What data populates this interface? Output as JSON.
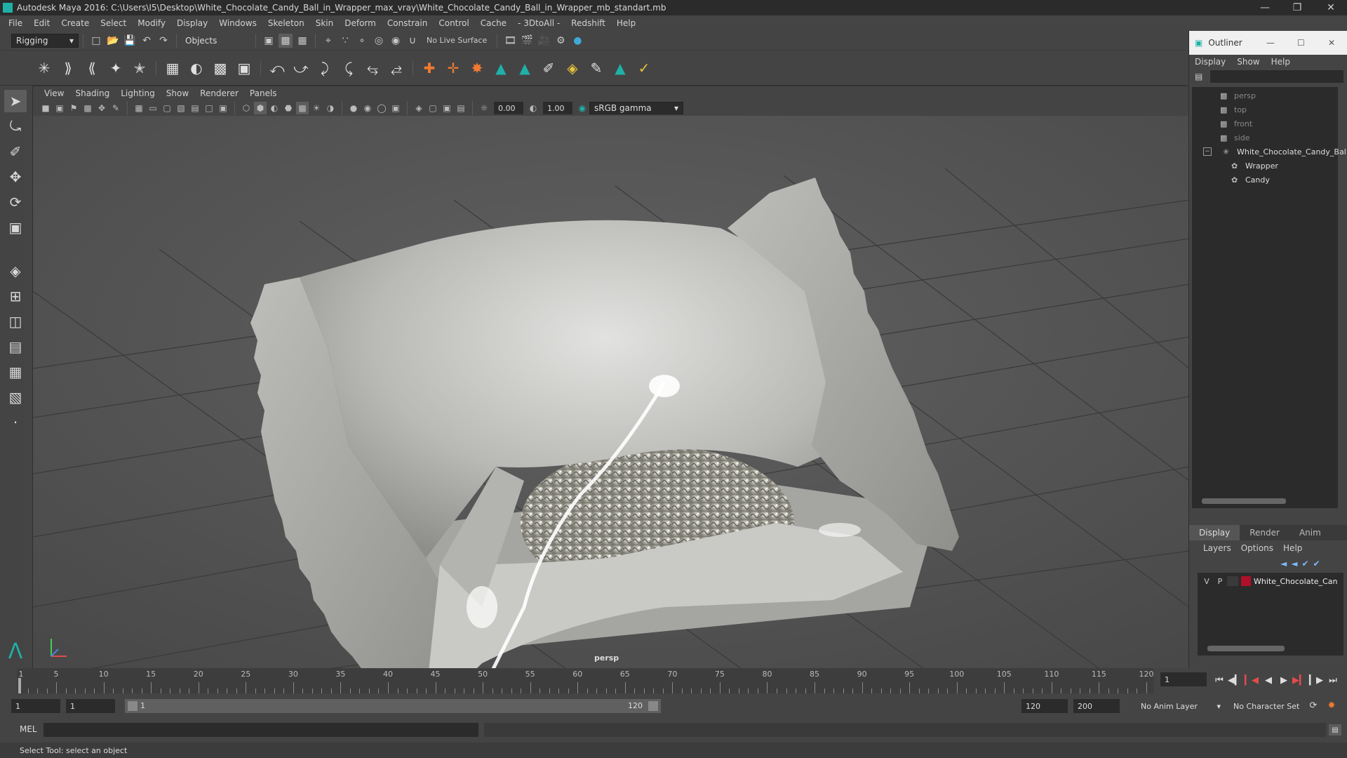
{
  "window": {
    "title": "Autodesk Maya 2016: C:\\Users\\I5\\Desktop\\White_Chocolate_Candy_Ball_in_Wrapper_max_vray\\White_Chocolate_Candy_Ball_in_Wrapper_mb_standart.mb"
  },
  "menubar": {
    "items": [
      "File",
      "Edit",
      "Create",
      "Select",
      "Modify",
      "Display",
      "Windows",
      "Skeleton",
      "Skin",
      "Deform",
      "Constrain",
      "Control",
      "Cache",
      "- 3DtoAll -",
      "Redshift",
      "Help"
    ]
  },
  "statusline": {
    "mode": "Rigging",
    "selection_mode": "Objects",
    "live_surface": "No Live Surface"
  },
  "viewport": {
    "menu": [
      "View",
      "Shading",
      "Lighting",
      "Show",
      "Renderer",
      "Panels"
    ],
    "exposure": "0.00",
    "gamma": "1.00",
    "color_space": "sRGB gamma",
    "camera_label": "persp"
  },
  "outliner": {
    "title": "Outliner",
    "menu": [
      "Display",
      "Show",
      "Help"
    ],
    "items": [
      {
        "label": "persp",
        "icon": "camera-icon"
      },
      {
        "label": "top",
        "icon": "camera-icon"
      },
      {
        "label": "front",
        "icon": "camera-icon"
      },
      {
        "label": "side",
        "icon": "camera-icon"
      },
      {
        "label": "White_Chocolate_Candy_Bal",
        "icon": "group-icon"
      },
      {
        "label": "Wrapper",
        "icon": "mesh-icon"
      },
      {
        "label": "Candy",
        "icon": "mesh-icon"
      }
    ]
  },
  "layers": {
    "tabs": [
      "Display",
      "Render",
      "Anim"
    ],
    "menu": [
      "Layers",
      "Options",
      "Help"
    ],
    "rows": [
      {
        "visible": "V",
        "playback": "P",
        "name": "White_Chocolate_Can",
        "color": "#b0102a"
      }
    ]
  },
  "timeline": {
    "ticks": [
      "1",
      "5",
      "10",
      "15",
      "20",
      "25",
      "30",
      "35",
      "40",
      "45",
      "50",
      "55",
      "60",
      "65",
      "70",
      "75",
      "80",
      "85",
      "90",
      "95",
      "100",
      "105",
      "110",
      "115",
      "120"
    ],
    "current_frame": "1"
  },
  "range": {
    "start": "1",
    "playback_start": "1",
    "bar_start": "1",
    "bar_end": "120",
    "playback_end": "120",
    "end": "200",
    "anim_layer": "No Anim Layer",
    "character_set": "No Character Set"
  },
  "cmdline": {
    "label": "MEL"
  },
  "helpline": {
    "text": "Select Tool: select an object"
  },
  "colors": {
    "accent": "#1fb0a8",
    "viewport_bg": "#3d3d3d",
    "panel_bg": "#444444"
  }
}
